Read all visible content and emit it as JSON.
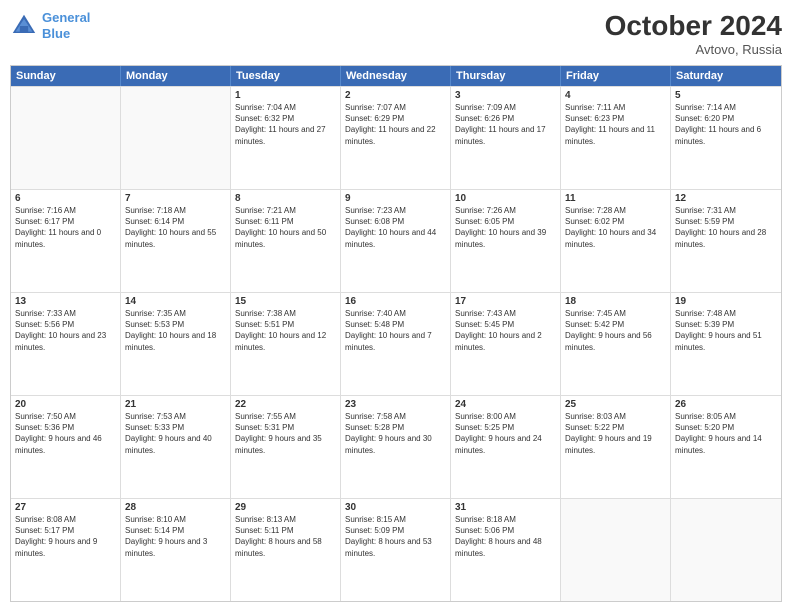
{
  "logo": {
    "line1": "General",
    "line2": "Blue"
  },
  "title": "October 2024",
  "location": "Avtovo, Russia",
  "header": {
    "days": [
      "Sunday",
      "Monday",
      "Tuesday",
      "Wednesday",
      "Thursday",
      "Friday",
      "Saturday"
    ]
  },
  "rows": [
    [
      {
        "day": "",
        "empty": true
      },
      {
        "day": "",
        "empty": true
      },
      {
        "day": "1",
        "sunrise": "Sunrise: 7:04 AM",
        "sunset": "Sunset: 6:32 PM",
        "daylight": "Daylight: 11 hours and 27 minutes."
      },
      {
        "day": "2",
        "sunrise": "Sunrise: 7:07 AM",
        "sunset": "Sunset: 6:29 PM",
        "daylight": "Daylight: 11 hours and 22 minutes."
      },
      {
        "day": "3",
        "sunrise": "Sunrise: 7:09 AM",
        "sunset": "Sunset: 6:26 PM",
        "daylight": "Daylight: 11 hours and 17 minutes."
      },
      {
        "day": "4",
        "sunrise": "Sunrise: 7:11 AM",
        "sunset": "Sunset: 6:23 PM",
        "daylight": "Daylight: 11 hours and 11 minutes."
      },
      {
        "day": "5",
        "sunrise": "Sunrise: 7:14 AM",
        "sunset": "Sunset: 6:20 PM",
        "daylight": "Daylight: 11 hours and 6 minutes."
      }
    ],
    [
      {
        "day": "6",
        "sunrise": "Sunrise: 7:16 AM",
        "sunset": "Sunset: 6:17 PM",
        "daylight": "Daylight: 11 hours and 0 minutes."
      },
      {
        "day": "7",
        "sunrise": "Sunrise: 7:18 AM",
        "sunset": "Sunset: 6:14 PM",
        "daylight": "Daylight: 10 hours and 55 minutes."
      },
      {
        "day": "8",
        "sunrise": "Sunrise: 7:21 AM",
        "sunset": "Sunset: 6:11 PM",
        "daylight": "Daylight: 10 hours and 50 minutes."
      },
      {
        "day": "9",
        "sunrise": "Sunrise: 7:23 AM",
        "sunset": "Sunset: 6:08 PM",
        "daylight": "Daylight: 10 hours and 44 minutes."
      },
      {
        "day": "10",
        "sunrise": "Sunrise: 7:26 AM",
        "sunset": "Sunset: 6:05 PM",
        "daylight": "Daylight: 10 hours and 39 minutes."
      },
      {
        "day": "11",
        "sunrise": "Sunrise: 7:28 AM",
        "sunset": "Sunset: 6:02 PM",
        "daylight": "Daylight: 10 hours and 34 minutes."
      },
      {
        "day": "12",
        "sunrise": "Sunrise: 7:31 AM",
        "sunset": "Sunset: 5:59 PM",
        "daylight": "Daylight: 10 hours and 28 minutes."
      }
    ],
    [
      {
        "day": "13",
        "sunrise": "Sunrise: 7:33 AM",
        "sunset": "Sunset: 5:56 PM",
        "daylight": "Daylight: 10 hours and 23 minutes."
      },
      {
        "day": "14",
        "sunrise": "Sunrise: 7:35 AM",
        "sunset": "Sunset: 5:53 PM",
        "daylight": "Daylight: 10 hours and 18 minutes."
      },
      {
        "day": "15",
        "sunrise": "Sunrise: 7:38 AM",
        "sunset": "Sunset: 5:51 PM",
        "daylight": "Daylight: 10 hours and 12 minutes."
      },
      {
        "day": "16",
        "sunrise": "Sunrise: 7:40 AM",
        "sunset": "Sunset: 5:48 PM",
        "daylight": "Daylight: 10 hours and 7 minutes."
      },
      {
        "day": "17",
        "sunrise": "Sunrise: 7:43 AM",
        "sunset": "Sunset: 5:45 PM",
        "daylight": "Daylight: 10 hours and 2 minutes."
      },
      {
        "day": "18",
        "sunrise": "Sunrise: 7:45 AM",
        "sunset": "Sunset: 5:42 PM",
        "daylight": "Daylight: 9 hours and 56 minutes."
      },
      {
        "day": "19",
        "sunrise": "Sunrise: 7:48 AM",
        "sunset": "Sunset: 5:39 PM",
        "daylight": "Daylight: 9 hours and 51 minutes."
      }
    ],
    [
      {
        "day": "20",
        "sunrise": "Sunrise: 7:50 AM",
        "sunset": "Sunset: 5:36 PM",
        "daylight": "Daylight: 9 hours and 46 minutes."
      },
      {
        "day": "21",
        "sunrise": "Sunrise: 7:53 AM",
        "sunset": "Sunset: 5:33 PM",
        "daylight": "Daylight: 9 hours and 40 minutes."
      },
      {
        "day": "22",
        "sunrise": "Sunrise: 7:55 AM",
        "sunset": "Sunset: 5:31 PM",
        "daylight": "Daylight: 9 hours and 35 minutes."
      },
      {
        "day": "23",
        "sunrise": "Sunrise: 7:58 AM",
        "sunset": "Sunset: 5:28 PM",
        "daylight": "Daylight: 9 hours and 30 minutes."
      },
      {
        "day": "24",
        "sunrise": "Sunrise: 8:00 AM",
        "sunset": "Sunset: 5:25 PM",
        "daylight": "Daylight: 9 hours and 24 minutes."
      },
      {
        "day": "25",
        "sunrise": "Sunrise: 8:03 AM",
        "sunset": "Sunset: 5:22 PM",
        "daylight": "Daylight: 9 hours and 19 minutes."
      },
      {
        "day": "26",
        "sunrise": "Sunrise: 8:05 AM",
        "sunset": "Sunset: 5:20 PM",
        "daylight": "Daylight: 9 hours and 14 minutes."
      }
    ],
    [
      {
        "day": "27",
        "sunrise": "Sunrise: 8:08 AM",
        "sunset": "Sunset: 5:17 PM",
        "daylight": "Daylight: 9 hours and 9 minutes."
      },
      {
        "day": "28",
        "sunrise": "Sunrise: 8:10 AM",
        "sunset": "Sunset: 5:14 PM",
        "daylight": "Daylight: 9 hours and 3 minutes."
      },
      {
        "day": "29",
        "sunrise": "Sunrise: 8:13 AM",
        "sunset": "Sunset: 5:11 PM",
        "daylight": "Daylight: 8 hours and 58 minutes."
      },
      {
        "day": "30",
        "sunrise": "Sunrise: 8:15 AM",
        "sunset": "Sunset: 5:09 PM",
        "daylight": "Daylight: 8 hours and 53 minutes."
      },
      {
        "day": "31",
        "sunrise": "Sunrise: 8:18 AM",
        "sunset": "Sunset: 5:06 PM",
        "daylight": "Daylight: 8 hours and 48 minutes."
      },
      {
        "day": "",
        "empty": true
      },
      {
        "day": "",
        "empty": true
      }
    ]
  ]
}
